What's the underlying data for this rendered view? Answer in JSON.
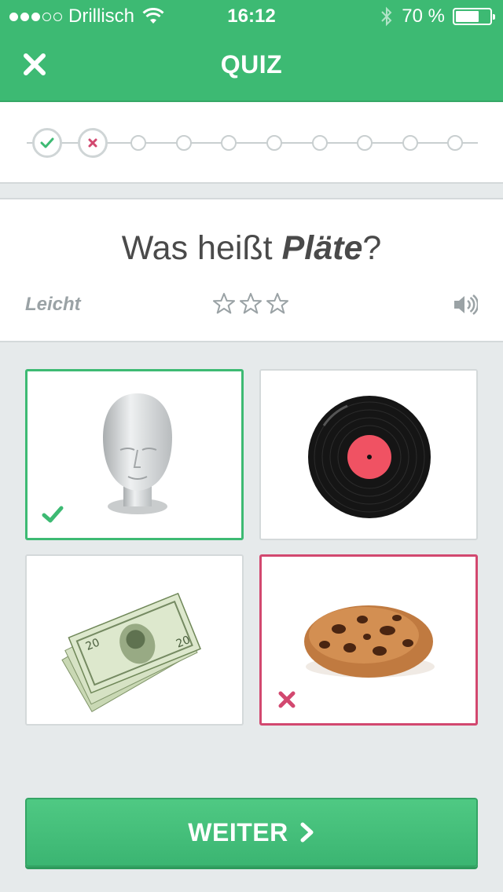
{
  "status_bar": {
    "carrier": "Drillisch",
    "time": "16:12",
    "battery": "70 %",
    "battery_level": 0.7,
    "signal_bars": 3,
    "signal_max": 5
  },
  "nav": {
    "title": "QUIZ",
    "close_icon": "close-icon"
  },
  "progress": {
    "steps": [
      "correct",
      "wrong",
      "pending",
      "pending",
      "pending",
      "pending",
      "pending",
      "pending",
      "pending",
      "pending"
    ]
  },
  "question": {
    "prefix": "Was heißt ",
    "word": "Pläte",
    "suffix": "?",
    "difficulty": "Leicht",
    "stars_filled": 0,
    "stars_total": 3
  },
  "answers": [
    {
      "image": "styrofoam-head",
      "state": "correct"
    },
    {
      "image": "vinyl-record",
      "state": "neutral"
    },
    {
      "image": "dollar-bills",
      "state": "neutral"
    },
    {
      "image": "cookie",
      "state": "wrong"
    }
  ],
  "continue_button": {
    "label": "WEITER"
  },
  "colors": {
    "brand_green": "#3dba73",
    "wrong_red": "#d2486f",
    "background": "#e6eaeb"
  }
}
